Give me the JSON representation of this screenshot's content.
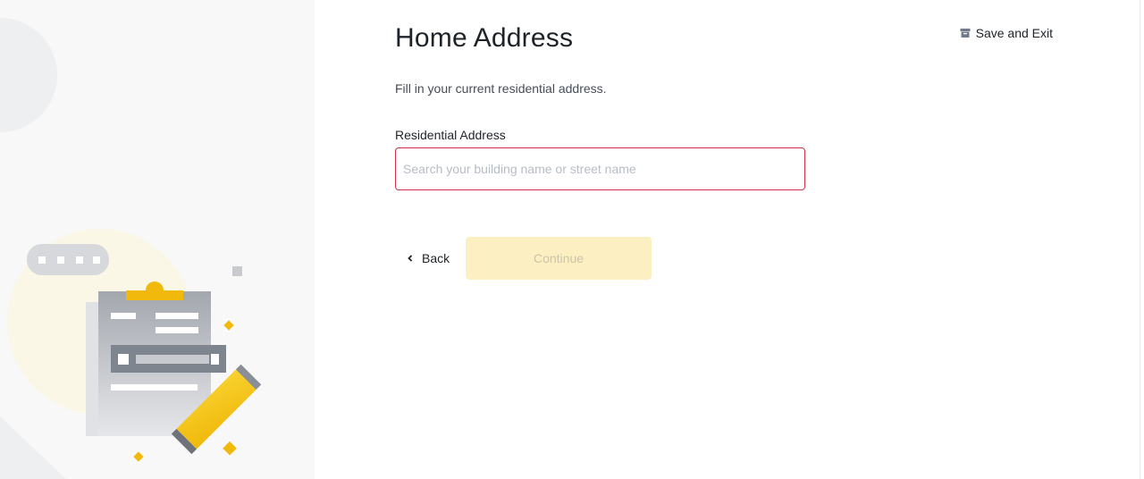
{
  "header": {
    "title": "Home Address",
    "subtitle": "Fill in your current residential address.",
    "save_exit_label": "Save and Exit",
    "save_exit_icon": "archive-box-icon"
  },
  "form": {
    "address_label": "Residential Address",
    "address_value": "",
    "address_placeholder": "Search your building name or street name"
  },
  "actions": {
    "back_label": "Back",
    "back_icon": "chevron-left-icon",
    "continue_label": "Continue",
    "continue_enabled": false
  },
  "colors": {
    "accent_yellow": "#f0b90b",
    "error_border": "#cf304a",
    "text_primary": "#1e2329",
    "continue_disabled_bg": "#fcf0c2"
  }
}
